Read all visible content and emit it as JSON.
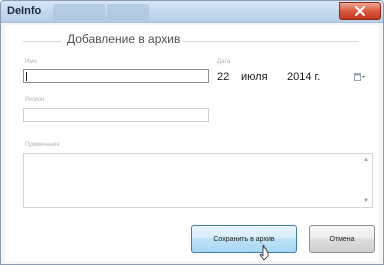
{
  "window": {
    "title": "DeInfo"
  },
  "form": {
    "section_title": "Добавление в архив",
    "name_label": "Имя",
    "name_value": "",
    "date_label": "Дата",
    "date": {
      "day": "22",
      "month": "июля",
      "year": "2014 г."
    },
    "region_label": "Регион",
    "region_value": "",
    "note_label": "Примечание",
    "note_value": ""
  },
  "buttons": {
    "save_label": "Сохранить в архив",
    "cancel_label": "Отмена"
  },
  "icons": {
    "close": "close-icon",
    "calendar": "calendar-dropdown-icon",
    "scroll_up": "scroll-up-icon",
    "scroll_down": "scroll-down-icon",
    "cursor": "mouse-cursor-icon"
  },
  "colors": {
    "close_button": "#c3371f",
    "primary_button_border": "#3c7fb1",
    "titlebar": "#c3d7ee"
  }
}
